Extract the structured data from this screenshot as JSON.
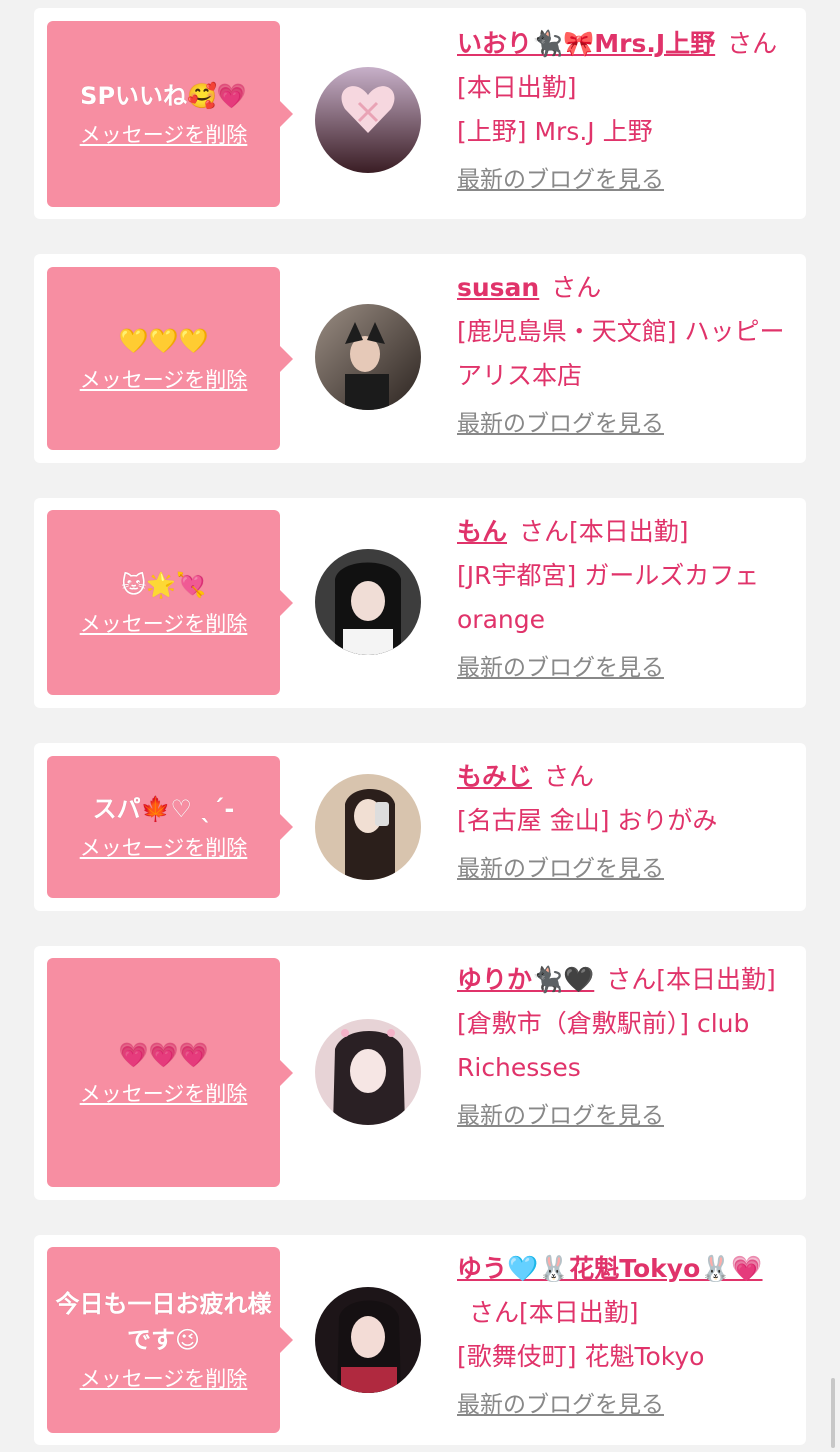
{
  "cards": [
    {
      "message": "SPいいね🥰💗",
      "delete_label": "メッセージを削除",
      "name": "いおり🐈‍⬛🎀Mrs.J上野",
      "san": "さん",
      "status": "[本日出勤]",
      "shop": "[上野] Mrs.J 上野",
      "blog_label": "最新のブログを見る",
      "avatar_colors": [
        "#c7b0c9",
        "#3a1d24"
      ]
    },
    {
      "message": "💛💛💛",
      "delete_label": "メッセージを削除",
      "name": "susan",
      "san": "さん",
      "status": "",
      "shop": "[鹿児島県・天文館] ハッピーアリス本店",
      "blog_label": "最新のブログを見る",
      "avatar_colors": [
        "#9a8d83",
        "#2c2420"
      ]
    },
    {
      "message": "🐱🌟💘",
      "delete_label": "メッセージを削除",
      "name": "もん",
      "san": "さん",
      "status": "[本日出勤]",
      "shop": "[JR宇都宮] ガールズカフェ orange",
      "blog_label": "最新のブログを見る",
      "avatar_colors": [
        "#5a5a5a",
        "#111111"
      ]
    },
    {
      "message": "スパ🍁♡ ˎˊ-",
      "delete_label": "メッセージを削除",
      "name": "もみじ",
      "san": "さん",
      "status": "",
      "shop": "[名古屋 金山] おりがみ",
      "blog_label": "最新のブログを見る",
      "avatar_colors": [
        "#d8c4ae",
        "#3b2a22"
      ]
    },
    {
      "message": "💗💗💗",
      "delete_label": "メッセージを削除",
      "name": "ゆりか🐈‍⬛🖤",
      "san": "さん",
      "status": "[本日出勤]",
      "shop": "[倉敷市（倉敷駅前）] club Richesses",
      "blog_label": "最新のブログを見る",
      "avatar_colors": [
        "#e7d3d6",
        "#2a2024"
      ]
    },
    {
      "message": "今日も一日お疲れ様です😉",
      "delete_label": "メッセージを削除",
      "name": "ゆう🩵🐰花魁Tokyo🐰💗",
      "san": "さん",
      "status": "[本日出勤]",
      "shop": "[歌舞伎町] 花魁Tokyo",
      "blog_label": "最新のブログを見る",
      "avatar_colors": [
        "#7a2f3a",
        "#1d1518"
      ]
    }
  ],
  "colors": {
    "bubble": "#f78ea2",
    "accent": "#e0336a",
    "link_gray": "#888888",
    "page_bg": "#f2f2f2"
  }
}
